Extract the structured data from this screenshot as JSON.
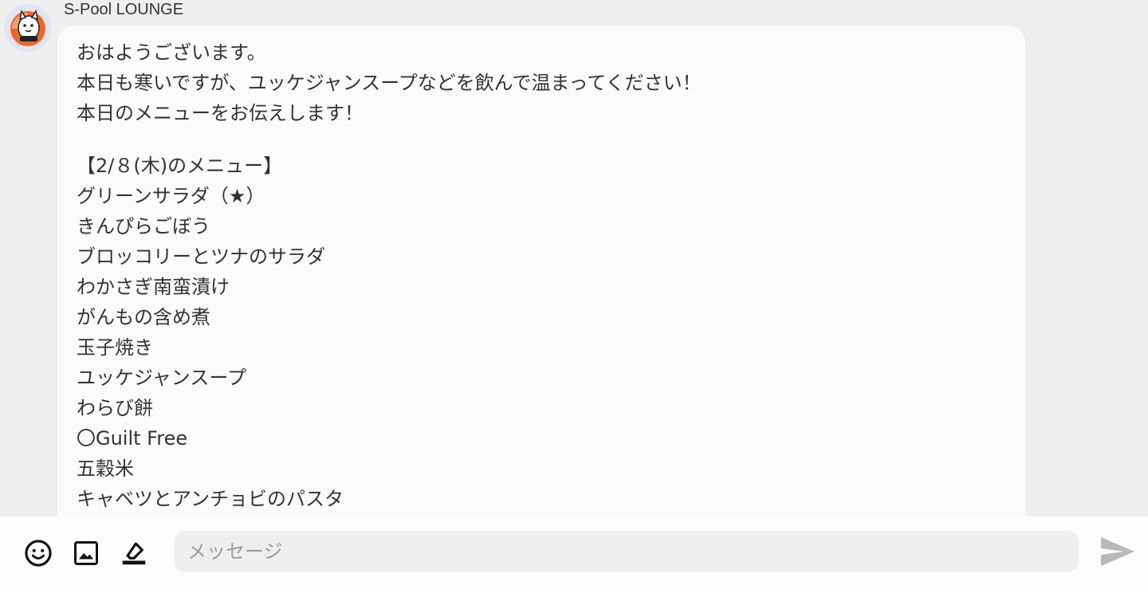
{
  "chat": {
    "sender_name": "S-Pool LOUNGE",
    "avatar_icon": "cat-mascot-icon",
    "message_paragraphs": [
      [
        "おはようございます。",
        "本日も寒いですが、ユッケジャンスープなどを飲んで温まってください！",
        "本日のメニューをお伝えします！"
      ],
      [
        "【2/８(木)のメニュー】",
        "グリーンサラダ（★）",
        "きんぴらごぼう",
        "ブロッコリーとツナのサラダ",
        "わかさぎ南蛮漬け",
        "がんもの含め煮",
        "玉子焼き",
        "ユッケジャンスープ",
        "わらび餅",
        "〇Guilt Free",
        "五穀米",
        "キャベツとアンチョビのパスタ",
        "〇"
      ]
    ]
  },
  "composer": {
    "placeholder": "メッセージ",
    "icons": {
      "emoji": "smiley-icon",
      "image": "image-icon",
      "draw": "draw-icon",
      "send": "send-icon"
    }
  },
  "colors": {
    "background": "#efefef",
    "bubble": "#fbfbfb",
    "text": "#333333",
    "avatar_accent": "#e8692e",
    "send_icon": "#b8b8b8"
  }
}
